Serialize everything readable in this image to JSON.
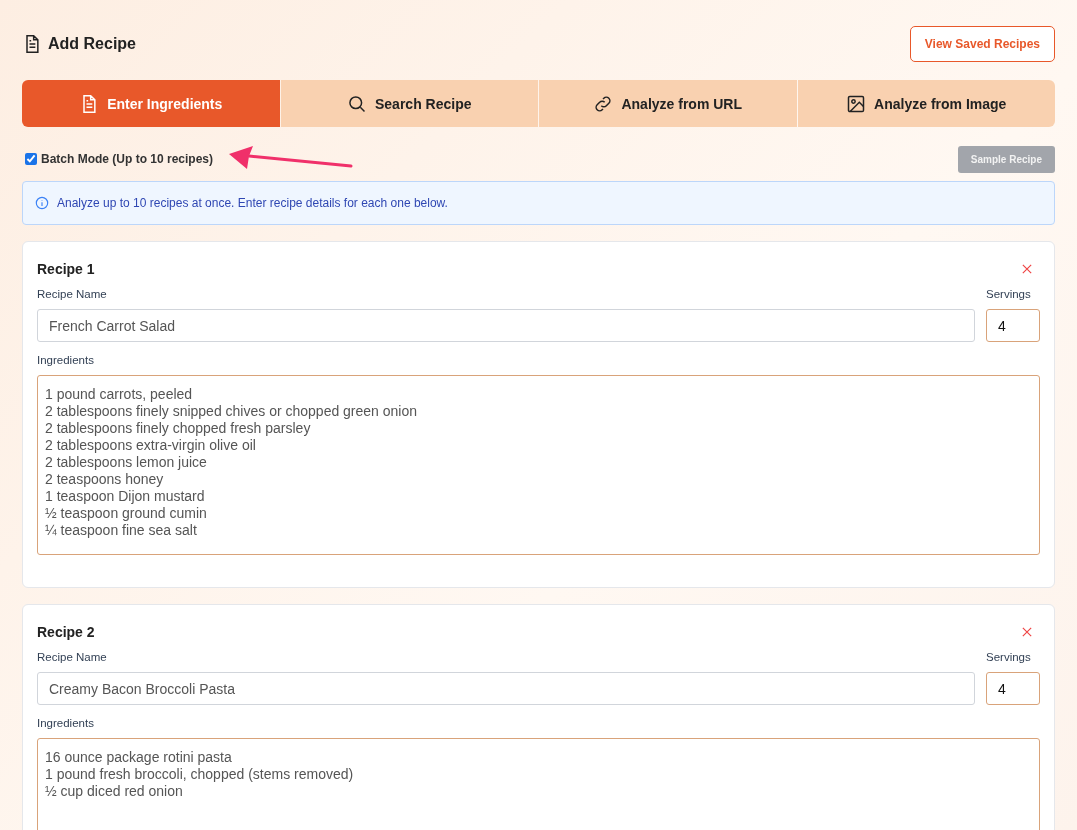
{
  "header": {
    "title": "Add Recipe",
    "saved_button": "View Saved Recipes"
  },
  "tabs": [
    {
      "label": "Enter Ingredients",
      "selected": true
    },
    {
      "label": "Search Recipe",
      "selected": false
    },
    {
      "label": "Analyze from URL",
      "selected": false
    },
    {
      "label": "Analyze from Image",
      "selected": false
    }
  ],
  "batch_mode": {
    "label": "Batch Mode (Up to 10 recipes)",
    "checked": true
  },
  "sample_button": {
    "label": "Sample Recipe",
    "disabled": true
  },
  "info": "Analyze up to 10 recipes at once. Enter recipe details for each one below.",
  "recipes": [
    {
      "title": "Recipe 1",
      "name_label": "Recipe Name",
      "name": "French Carrot Salad",
      "servings_label": "Servings",
      "servings": "4",
      "ingredients_label": "Ingredients",
      "ingredients": [
        "1 pound carrots, peeled",
        "2 tablespoons finely snipped chives or chopped green onion",
        "2 tablespoons finely chopped fresh parsley",
        "2 tablespoons extra-virgin olive oil",
        "2 tablespoons lemon juice",
        "2 teaspoons honey",
        "1 teaspoon Dijon mustard",
        "½ teaspoon ground cumin",
        "¼ teaspoon fine sea salt"
      ]
    },
    {
      "title": "Recipe 2",
      "name_label": "Recipe Name",
      "name": "Creamy Bacon Broccoli Pasta",
      "servings_label": "Servings",
      "servings": "4",
      "ingredients_label": "Ingredients",
      "ingredients": [
        "16 ounce package rotini pasta",
        "1 pound fresh broccoli, chopped (stems removed)",
        "½ cup diced red onion"
      ]
    }
  ]
}
